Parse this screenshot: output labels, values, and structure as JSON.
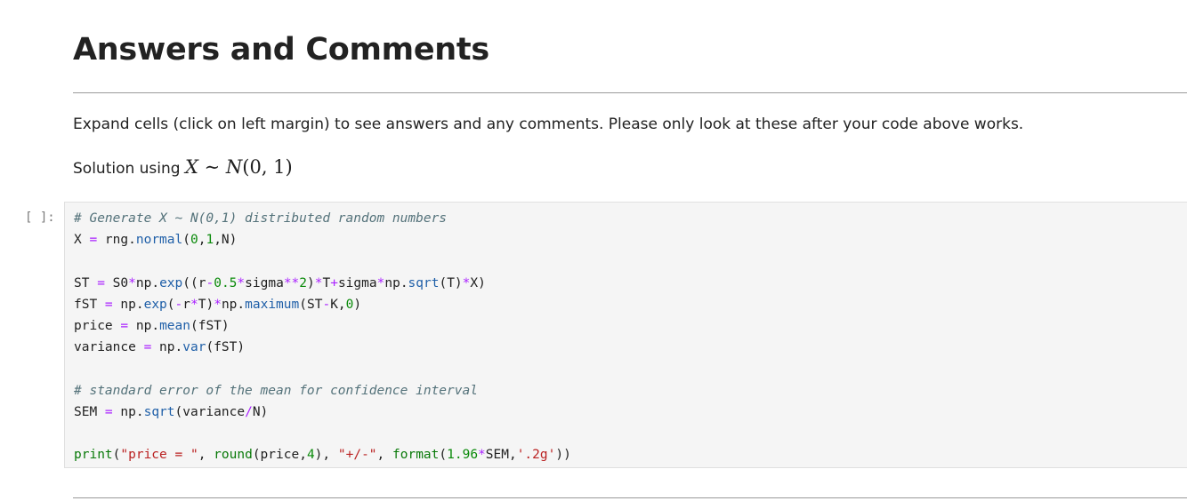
{
  "notebook": {
    "heading": "Answers and Comments",
    "intro_text": "Expand cells (click on left margin) to see answers and any comments. Please only look at these after your code above works.",
    "solution_prefix": "Solution using ",
    "solution_math": {
      "lhs": "X",
      "op": " ∼ ",
      "dist": "N",
      "args": "(0, 1)"
    },
    "cell": {
      "prompt": "[ ]:",
      "lines": [
        [
          [
            "comment",
            "# Generate X ~ N(0,1) distributed random numbers"
          ]
        ],
        [
          [
            "plain",
            "X "
          ],
          [
            "op",
            "="
          ],
          [
            "plain",
            " rng"
          ],
          [
            "plain",
            "."
          ],
          [
            "attr",
            "normal"
          ],
          [
            "plain",
            "("
          ],
          [
            "num",
            "0"
          ],
          [
            "plain",
            ","
          ],
          [
            "num",
            "1"
          ],
          [
            "plain",
            ",N)"
          ]
        ],
        [],
        [
          [
            "plain",
            "ST "
          ],
          [
            "op",
            "="
          ],
          [
            "plain",
            " S0"
          ],
          [
            "op",
            "*"
          ],
          [
            "plain",
            "np"
          ],
          [
            "plain",
            "."
          ],
          [
            "attr",
            "exp"
          ],
          [
            "plain",
            "((r"
          ],
          [
            "op",
            "-"
          ],
          [
            "num",
            "0.5"
          ],
          [
            "op",
            "*"
          ],
          [
            "plain",
            "sigma"
          ],
          [
            "op",
            "**"
          ],
          [
            "num",
            "2"
          ],
          [
            "plain",
            ")"
          ],
          [
            "op",
            "*"
          ],
          [
            "plain",
            "T"
          ],
          [
            "op",
            "+"
          ],
          [
            "plain",
            "sigma"
          ],
          [
            "op",
            "*"
          ],
          [
            "plain",
            "np"
          ],
          [
            "plain",
            "."
          ],
          [
            "attr",
            "sqrt"
          ],
          [
            "plain",
            "(T)"
          ],
          [
            "op",
            "*"
          ],
          [
            "plain",
            "X)"
          ]
        ],
        [
          [
            "plain",
            "fST "
          ],
          [
            "op",
            "="
          ],
          [
            "plain",
            " np"
          ],
          [
            "plain",
            "."
          ],
          [
            "attr",
            "exp"
          ],
          [
            "plain",
            "("
          ],
          [
            "op",
            "-"
          ],
          [
            "plain",
            "r"
          ],
          [
            "op",
            "*"
          ],
          [
            "plain",
            "T)"
          ],
          [
            "op",
            "*"
          ],
          [
            "plain",
            "np"
          ],
          [
            "plain",
            "."
          ],
          [
            "attr",
            "maximum"
          ],
          [
            "plain",
            "(ST"
          ],
          [
            "op",
            "-"
          ],
          [
            "plain",
            "K,"
          ],
          [
            "num",
            "0"
          ],
          [
            "plain",
            ")"
          ]
        ],
        [
          [
            "plain",
            "price "
          ],
          [
            "op",
            "="
          ],
          [
            "plain",
            " np"
          ],
          [
            "plain",
            "."
          ],
          [
            "attr",
            "mean"
          ],
          [
            "plain",
            "(fST)"
          ]
        ],
        [
          [
            "plain",
            "variance "
          ],
          [
            "op",
            "="
          ],
          [
            "plain",
            " np"
          ],
          [
            "plain",
            "."
          ],
          [
            "attr",
            "var"
          ],
          [
            "plain",
            "(fST)"
          ]
        ],
        [],
        [
          [
            "comment",
            "# standard error of the mean for confidence interval"
          ]
        ],
        [
          [
            "plain",
            "SEM "
          ],
          [
            "op",
            "="
          ],
          [
            "plain",
            " np"
          ],
          [
            "plain",
            "."
          ],
          [
            "attr",
            "sqrt"
          ],
          [
            "plain",
            "(variance"
          ],
          [
            "op",
            "/"
          ],
          [
            "plain",
            "N)"
          ]
        ],
        [],
        [
          [
            "builtin",
            "print"
          ],
          [
            "plain",
            "("
          ],
          [
            "str",
            "\"price = \""
          ],
          [
            "plain",
            ", "
          ],
          [
            "builtin",
            "round"
          ],
          [
            "plain",
            "(price,"
          ],
          [
            "num",
            "4"
          ],
          [
            "plain",
            "), "
          ],
          [
            "str",
            "\"+/-\""
          ],
          [
            "plain",
            ", "
          ],
          [
            "builtin",
            "format"
          ],
          [
            "plain",
            "("
          ],
          [
            "num",
            "1.96"
          ],
          [
            "op",
            "*"
          ],
          [
            "plain",
            "SEM,"
          ],
          [
            "str",
            "'.2g'"
          ],
          [
            "plain",
            "))"
          ]
        ]
      ]
    }
  }
}
